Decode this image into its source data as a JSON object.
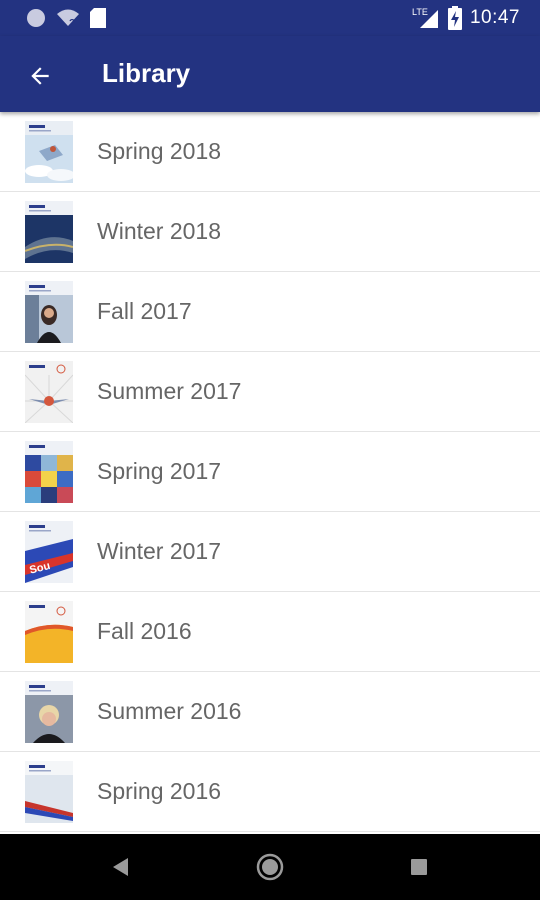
{
  "status_bar": {
    "time": "10:47",
    "network": "LTE",
    "icons": [
      "circle-status-icon",
      "wifi-unknown-icon",
      "sd-card-icon",
      "lte-signal-icon",
      "battery-charging-icon"
    ]
  },
  "app_bar": {
    "title": "Library",
    "back_icon": "arrow-back-icon",
    "background": "#233381"
  },
  "library": {
    "items": [
      {
        "label": "Spring 2018",
        "cover": "cover-spring-2018"
      },
      {
        "label": "Winter 2018",
        "cover": "cover-winter-2018"
      },
      {
        "label": "Fall 2017",
        "cover": "cover-fall-2017"
      },
      {
        "label": "Summer 2017",
        "cover": "cover-summer-2017"
      },
      {
        "label": "Spring 2017",
        "cover": "cover-spring-2017"
      },
      {
        "label": "Winter 2017",
        "cover": "cover-winter-2017"
      },
      {
        "label": "Fall 2016",
        "cover": "cover-fall-2016"
      },
      {
        "label": "Summer 2016",
        "cover": "cover-summer-2016"
      },
      {
        "label": "Spring 2016",
        "cover": "cover-spring-2016"
      }
    ]
  },
  "nav_bar": {
    "icons": [
      "back-triangle-icon",
      "home-circle-icon",
      "recents-square-icon"
    ]
  }
}
